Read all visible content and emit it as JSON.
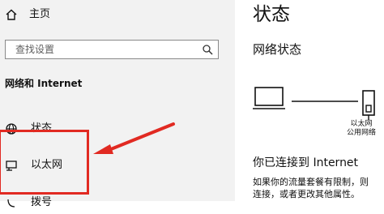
{
  "sidebar": {
    "home_label": "主页",
    "search_placeholder": "查找设置",
    "section_label": "网络和 Internet",
    "items": [
      {
        "label": "状态"
      },
      {
        "label": "以太网"
      },
      {
        "label": "拨号"
      }
    ]
  },
  "main": {
    "title": "状态",
    "subtitle": "网络状态",
    "diagram_label_line1": "以太网",
    "diagram_label_line2": "公用网络",
    "connected_heading": "你已连接到 Internet",
    "connected_text_line1": "如果你的流量套餐有限制，则",
    "connected_text_line2": "连接，或者更改其他属性。"
  },
  "colors": {
    "sidebar_bg": "#f2f2f2",
    "highlight": "#e12a22"
  },
  "icons": [
    "home-icon",
    "search-icon",
    "globe-icon",
    "ethernet-icon",
    "monitor-icon",
    "network-port-icon"
  ]
}
